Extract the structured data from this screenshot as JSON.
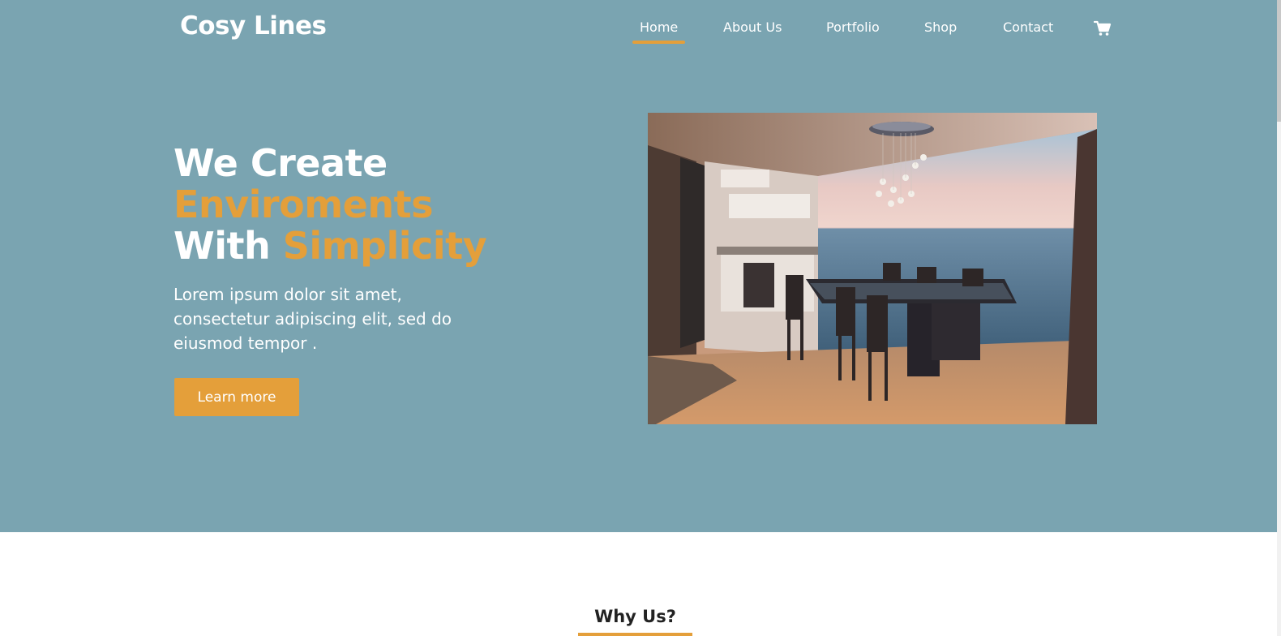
{
  "brand": {
    "name": "Cosy Lines"
  },
  "nav": {
    "items": [
      {
        "label": "Home",
        "active": true
      },
      {
        "label": "About Us",
        "active": false
      },
      {
        "label": "Portfolio",
        "active": false
      },
      {
        "label": "Shop",
        "active": false
      },
      {
        "label": "Contact",
        "active": false
      }
    ],
    "cart_icon": "shopping-cart-icon"
  },
  "hero": {
    "headline": {
      "line1": "We Create",
      "line2": "Enviroments",
      "line3_white": "With",
      "line3_accent": "Simplicity"
    },
    "lead": "Lorem ipsum dolor sit amet, consectetur adipiscing elit, sed do eiusmod tempor .",
    "cta_label": "Learn more",
    "image_icon": "dining-room-ocean-view-photo"
  },
  "why_us": {
    "title": "Why Us?"
  },
  "colors": {
    "hero_background": "#7aa4b1",
    "accent": "#e49f3a",
    "text_light": "#ffffff",
    "text_dark": "#222222"
  }
}
